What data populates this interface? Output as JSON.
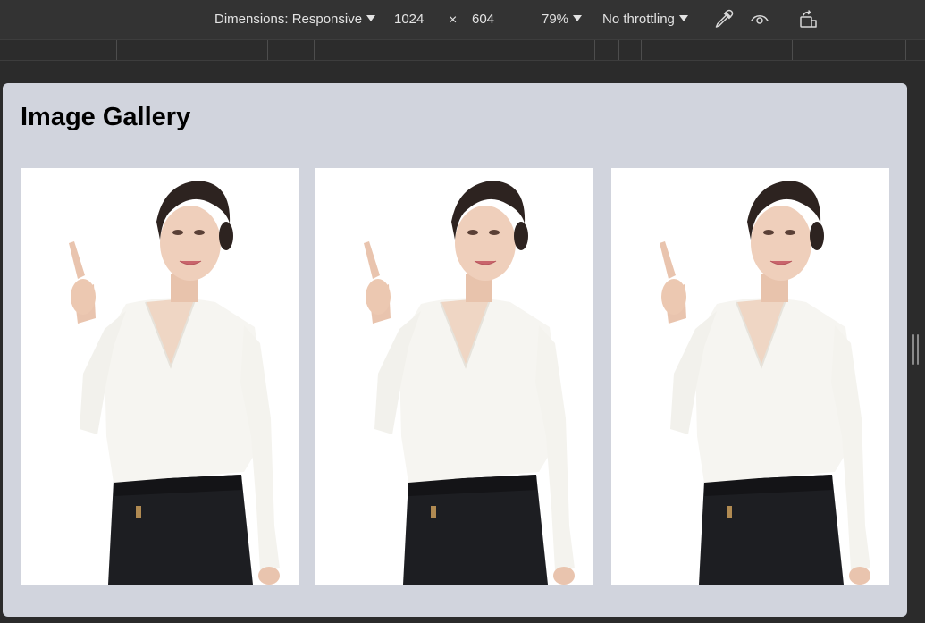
{
  "toolbar": {
    "dimensions_label": "Dimensions: Responsive",
    "width_value": "1024",
    "times_symbol": "×",
    "height_value": "604",
    "zoom_label": "79%",
    "throttling_label": "No throttling",
    "icons": [
      "eyedropper-icon",
      "eye-icon",
      "rotate-icon"
    ]
  },
  "page": {
    "title": "Image Gallery",
    "background_color": "#d1d4dd",
    "images": [
      {
        "subject": "woman in white blouse pointing up"
      },
      {
        "subject": "woman in white blouse pointing up"
      },
      {
        "subject": "woman in white blouse pointing up"
      }
    ]
  }
}
